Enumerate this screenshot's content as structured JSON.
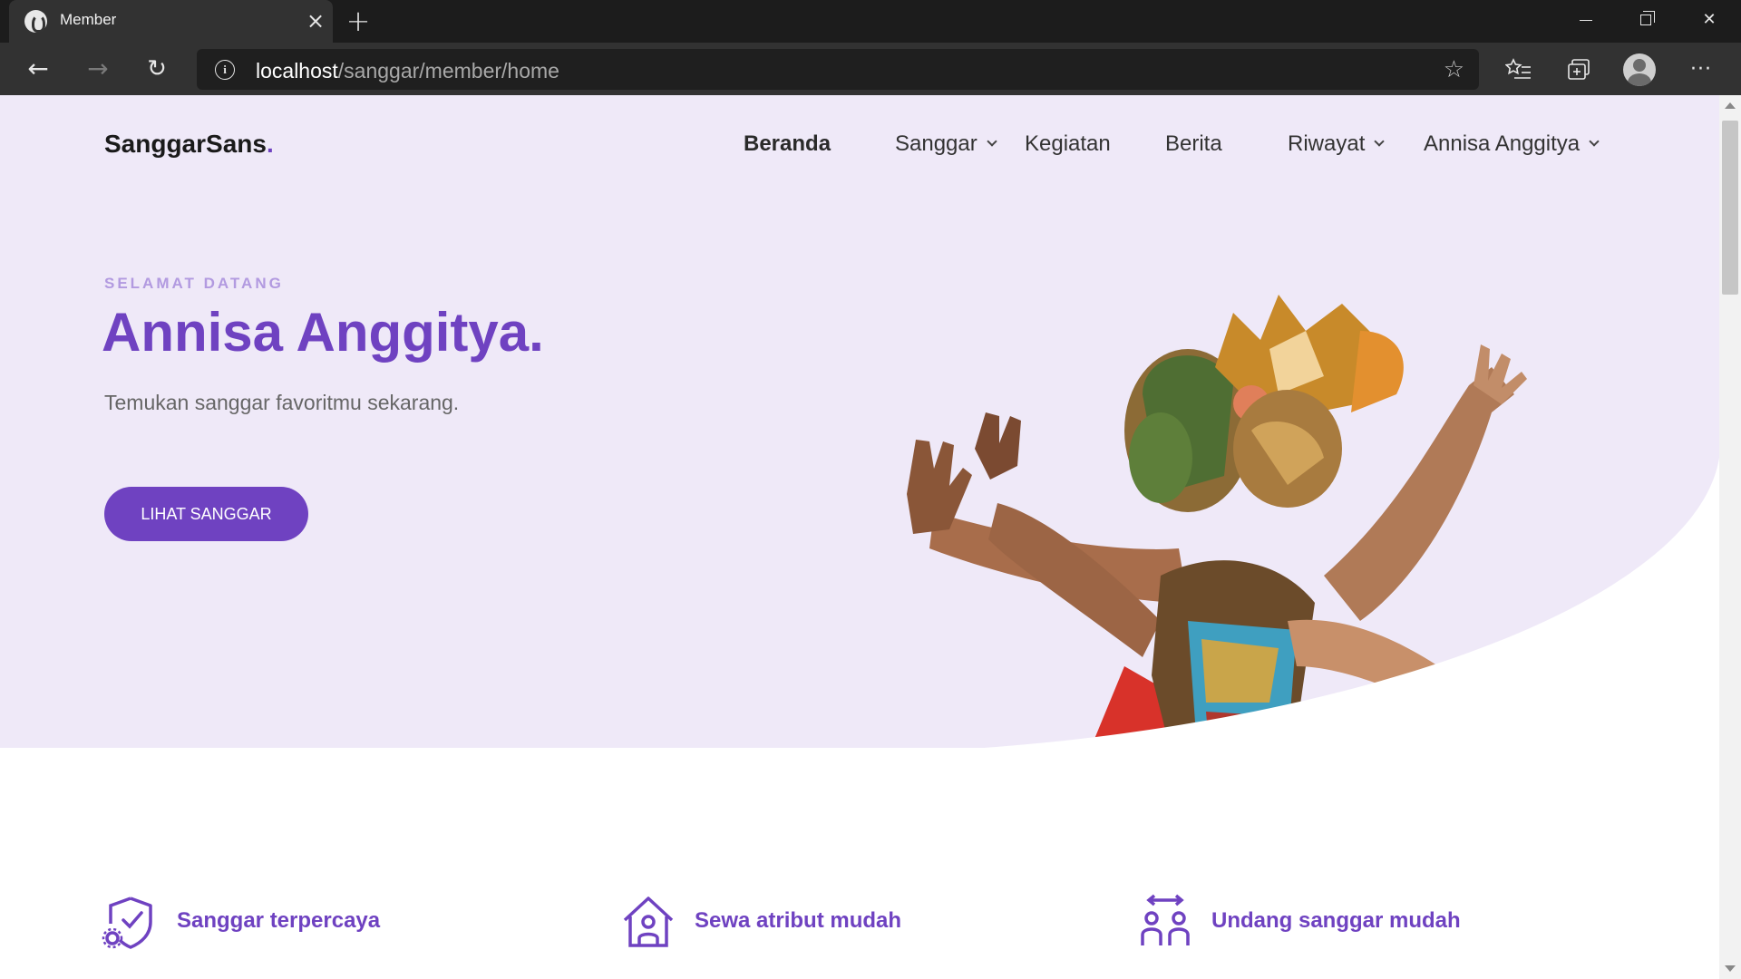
{
  "browser": {
    "tab_title": "Member",
    "address_host": "localhost",
    "address_path": "/sanggar/member/home"
  },
  "site": {
    "brand": "SanggarSans",
    "brand_dot": ".",
    "nav": {
      "beranda": "Beranda",
      "sanggar": "Sanggar",
      "kegiatan": "Kegiatan",
      "berita": "Berita",
      "riwayat": "Riwayat",
      "user": "Annisa Anggitya"
    }
  },
  "hero": {
    "eyebrow": "SELAMAT DATANG",
    "title": "Annisa Anggitya.",
    "subtitle": "Temukan sanggar favoritmu sekarang.",
    "cta": "LIHAT SANGGAR"
  },
  "features": [
    {
      "label": "Sanggar terpercaya",
      "icon": "shield-check-icon"
    },
    {
      "label": "Sewa atribut mudah",
      "icon": "house-person-icon"
    },
    {
      "label": "Undang sanggar mudah",
      "icon": "people-arrows-icon"
    }
  ],
  "colors": {
    "accent": "#6f42c1",
    "hero_bg": "#efe9f8",
    "eyebrow": "#b29ae0"
  }
}
